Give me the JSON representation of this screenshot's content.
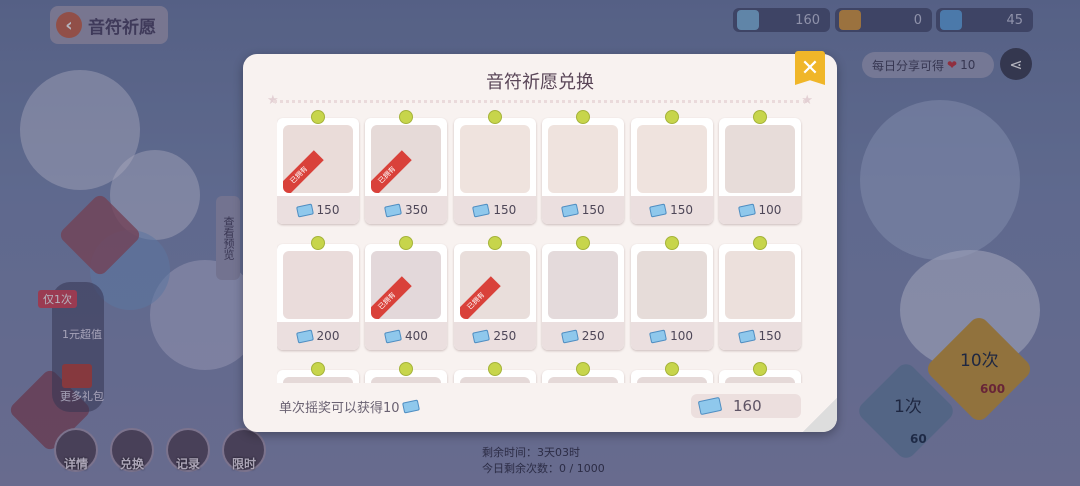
{
  "header": {
    "title": "音符祈愿"
  },
  "resources": [
    {
      "icon": "ticket-icon",
      "value": "160"
    },
    {
      "icon": "carrot-icon",
      "value": "0"
    },
    {
      "icon": "diamond-icon",
      "value": "45"
    }
  ],
  "share": {
    "text": "每日分享可得",
    "count": "10"
  },
  "side": {
    "once_tag": "仅1次",
    "deal_label": "1元超值",
    "more_label": "更多礼包",
    "preview_label": "查看预览"
  },
  "bottom_nav": [
    {
      "label": "详情",
      "icon": "details-icon"
    },
    {
      "label": "兑换",
      "icon": "exchange-icon"
    },
    {
      "label": "记录",
      "icon": "record-icon"
    },
    {
      "label": "限时",
      "icon": "limited-icon"
    }
  ],
  "draw": {
    "ten": {
      "label": "10次",
      "cost": "600"
    },
    "one": {
      "label": "1次",
      "cost": "60"
    }
  },
  "bottom_text": {
    "line1": "剩余时间：3天03时",
    "line2": "今日剩余次数：0 / 1000"
  },
  "modal": {
    "title": "音符祈愿兑换",
    "owned_label": "已拥有",
    "items": [
      {
        "name": "cinnamoroll-hat-item",
        "price": "150",
        "owned": true
      },
      {
        "name": "blue-wig-item",
        "price": "350",
        "owned": true
      },
      {
        "name": "blue-eyes-face-item",
        "price": "150",
        "owned": false
      },
      {
        "name": "blush-face-item",
        "price": "150",
        "owned": false
      },
      {
        "name": "pompompurin-face-item",
        "price": "150",
        "owned": false
      },
      {
        "name": "card-accessory-item",
        "price": "100",
        "owned": false
      },
      {
        "name": "pink-jacket-item",
        "price": "200",
        "owned": false
      },
      {
        "name": "blue-dress-item",
        "price": "400",
        "owned": true
      },
      {
        "name": "cinnamoroll-wand-item",
        "price": "250",
        "owned": true
      },
      {
        "name": "cinnamoroll-plush-item",
        "price": "250",
        "owned": false
      },
      {
        "name": "sneakers-item",
        "price": "100",
        "owned": false
      },
      {
        "name": "bunny-bag-item",
        "price": "150",
        "owned": false
      },
      {
        "name": "hidden-item-13",
        "price": "",
        "owned": false
      },
      {
        "name": "hidden-item-14",
        "price": "",
        "owned": false
      },
      {
        "name": "hidden-item-15",
        "price": "",
        "owned": false
      },
      {
        "name": "hidden-item-16",
        "price": "",
        "owned": false
      },
      {
        "name": "hidden-item-17",
        "price": "",
        "owned": false
      },
      {
        "name": "hidden-item-18",
        "price": "",
        "owned": false
      }
    ],
    "footer_note": "单次摇奖可以获得10",
    "balance": "160"
  },
  "colors": {
    "accent": "#f0b629",
    "owned_ribbon": "#d9413a",
    "pin": "#c7d54b",
    "ticket": "#8fc8ec"
  }
}
